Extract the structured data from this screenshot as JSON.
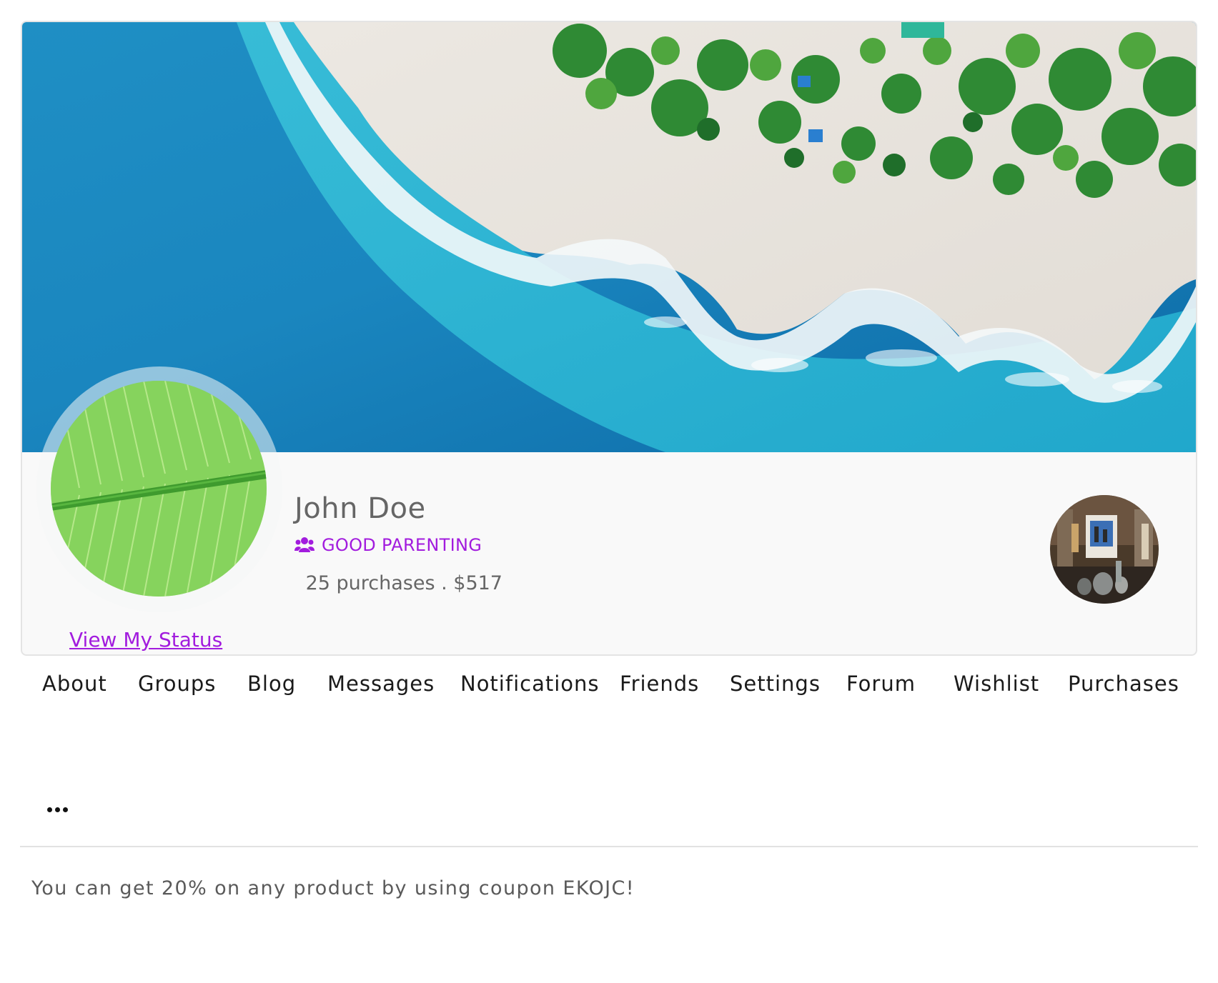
{
  "profile": {
    "name": "John Doe",
    "group_label": "GOOD PARENTING",
    "group_icon": "users-icon",
    "stats": " 25 purchases . $517",
    "status_link": "View My Status",
    "accent_color": "#a21cde"
  },
  "nav": {
    "items": [
      {
        "label": "About"
      },
      {
        "label": "Groups"
      },
      {
        "label": "Blog"
      },
      {
        "label": "Messages"
      },
      {
        "label": "Notifications"
      },
      {
        "label": "Friends"
      },
      {
        "label": "Settings"
      },
      {
        "label": "Forum"
      },
      {
        "label": "Wishlist"
      },
      {
        "label": "Purchases"
      }
    ],
    "more_icon": "ellipsis-icon"
  },
  "notice": {
    "text": "You can get 20% on any product by using coupon EKOJC!"
  }
}
